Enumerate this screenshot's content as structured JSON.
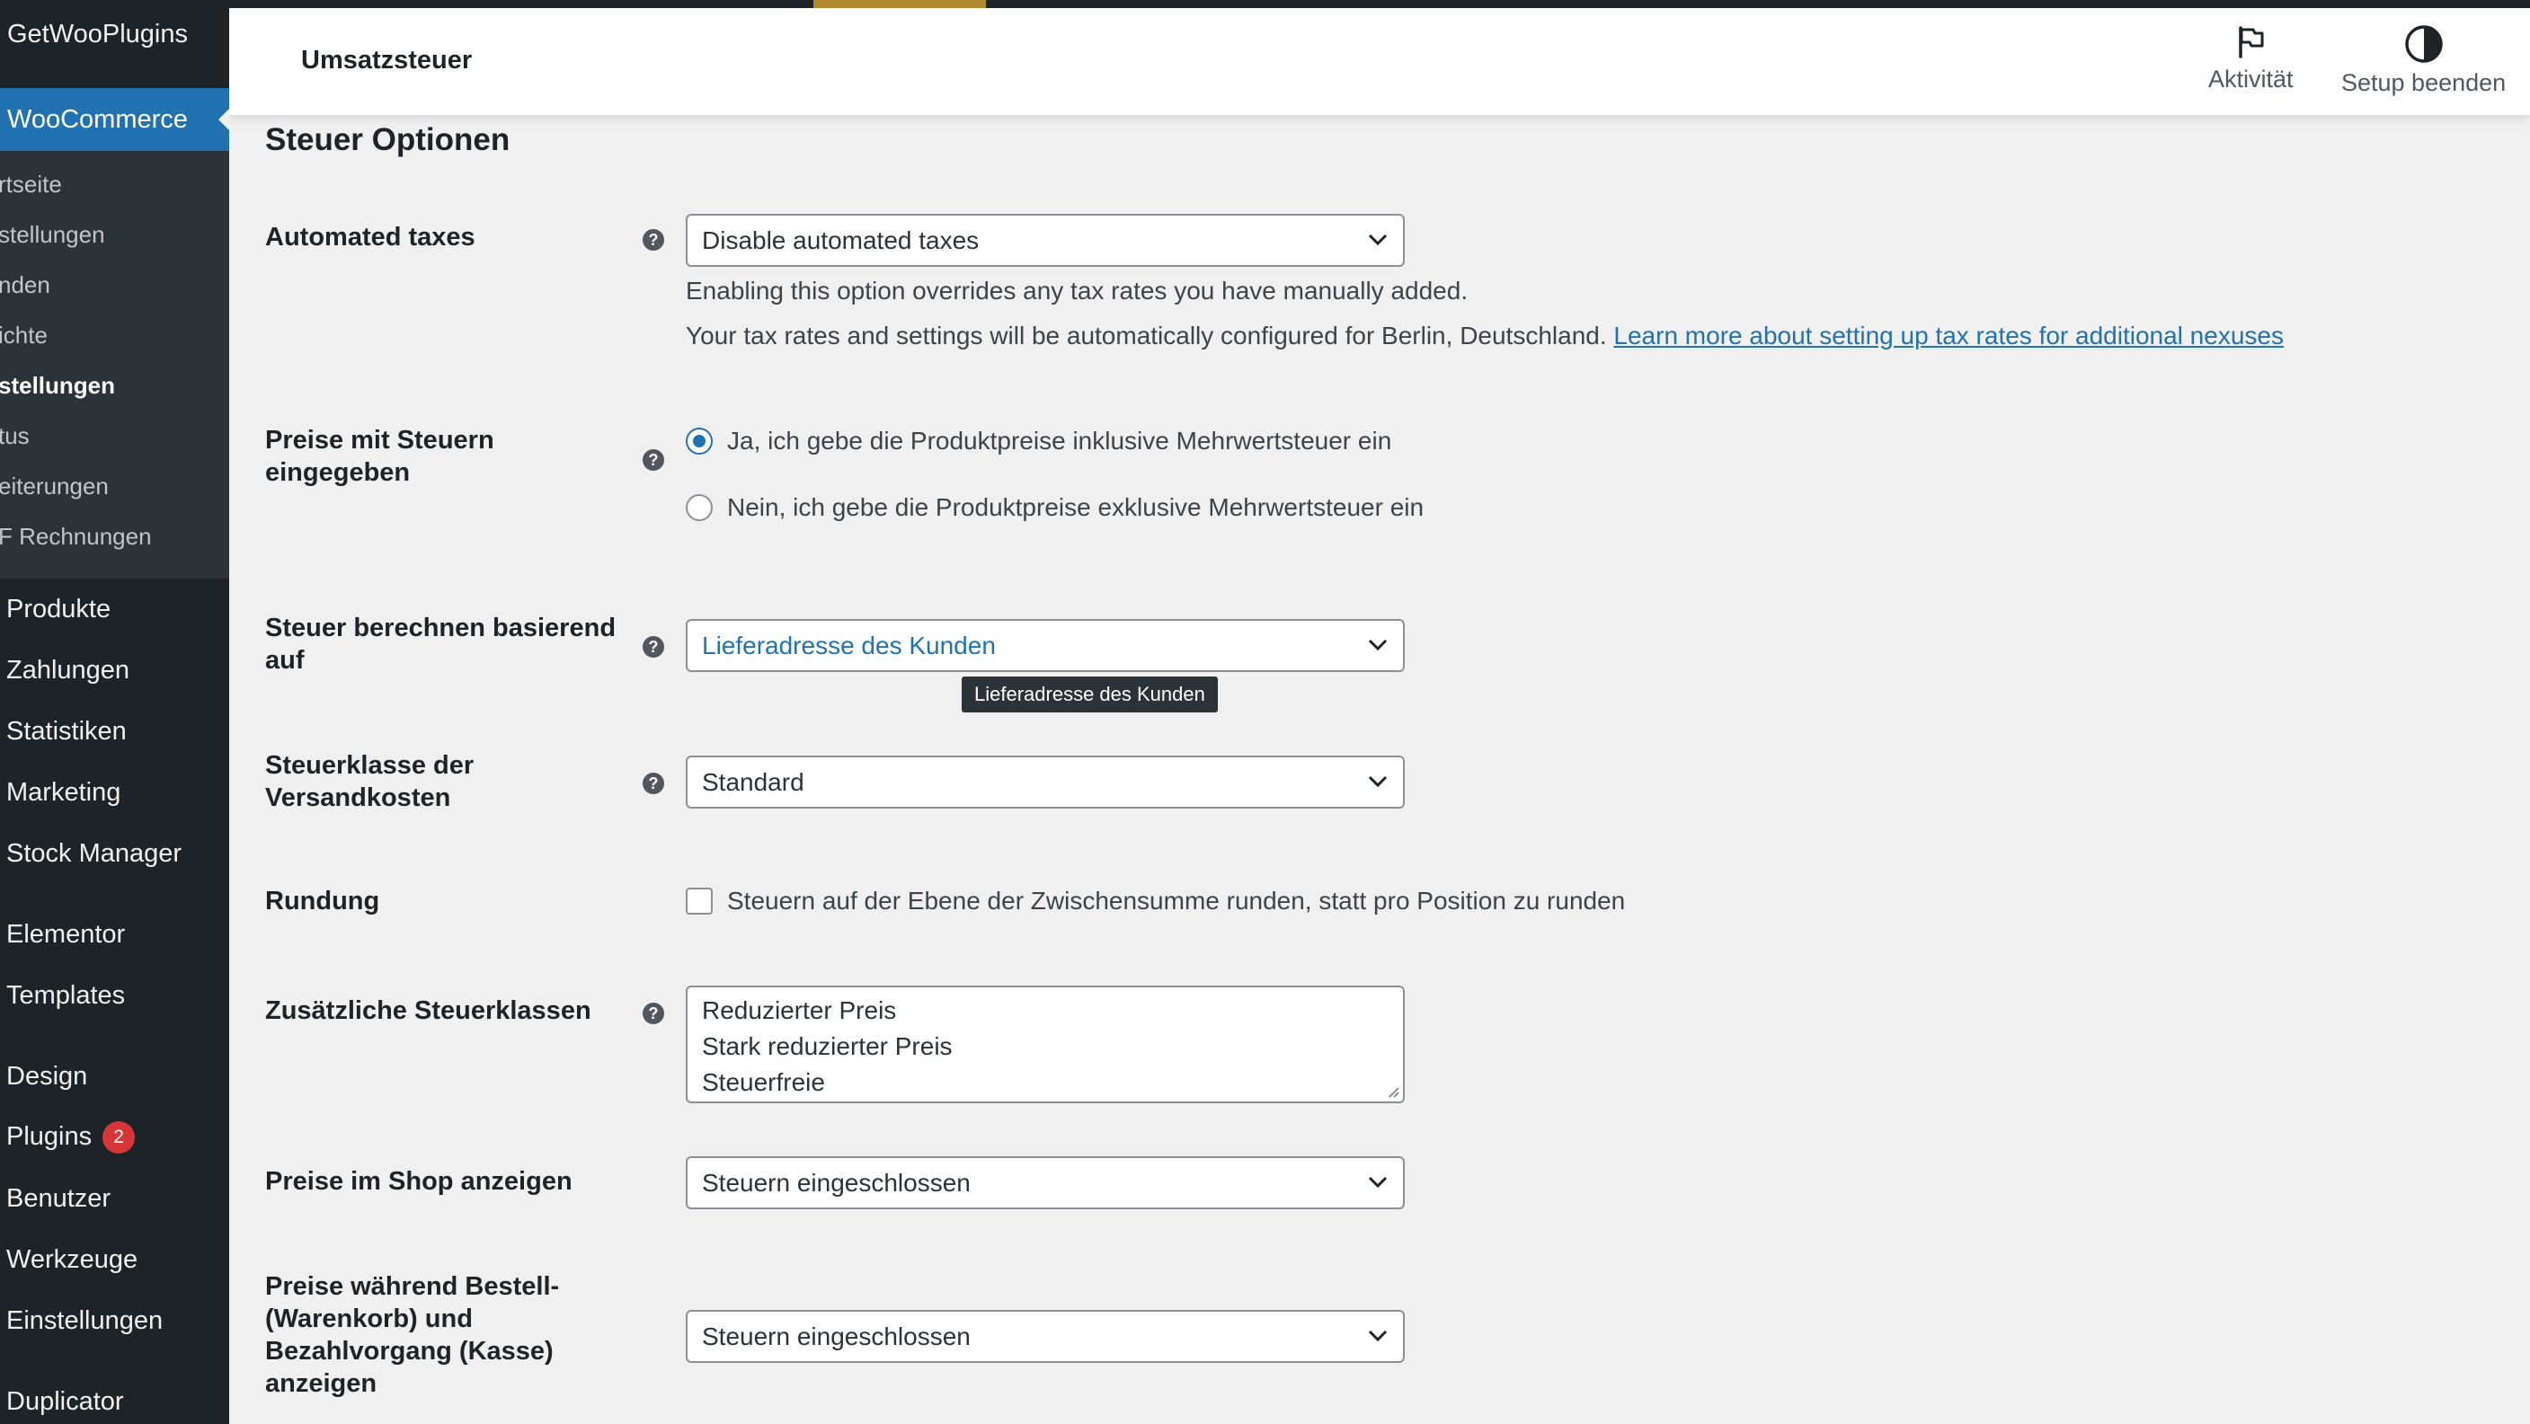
{
  "sidebar": {
    "brand": "GetWooPlugins",
    "woocommerce": "WooCommerce",
    "subitems": [
      "rtseite",
      "stellungen",
      "nden",
      "ichte",
      "stellungen",
      "tus",
      "eiterungen",
      "F Rechnungen"
    ],
    "items": [
      "Produkte",
      "Zahlungen",
      "Statistiken",
      "Marketing",
      "Stock Manager",
      "Elementor",
      "Templates",
      "Design",
      "Plugins",
      "Benutzer",
      "Werkzeuge",
      "Einstellungen",
      "Duplicator"
    ],
    "plugins_badge": "2"
  },
  "header": {
    "title": "Umsatzsteuer",
    "activity_label": "Aktivität",
    "setup_label": "Setup beenden"
  },
  "main": {
    "section_title": "Steuer Optionen",
    "automated_taxes": {
      "label": "Automated taxes",
      "value": "Disable automated taxes",
      "desc1": "Enabling this option overrides any tax rates you have manually added.",
      "desc2": "Your tax rates and settings will be automatically configured for Berlin, Deutschland.",
      "link": "Learn more about setting up tax rates for additional nexuses"
    },
    "prices_entered": {
      "label": "Preise mit Steuern eingegeben",
      "option_yes": "Ja, ich gebe die Produktpreise inklusive Mehrwertsteuer ein",
      "option_no": "Nein, ich gebe die Produktpreise exklusive Mehrwertsteuer ein"
    },
    "calc_based_on": {
      "label": "Steuer berechnen basierend auf",
      "value": "Lieferadresse des Kunden",
      "tooltip": "Lieferadresse des Kunden"
    },
    "shipping_class": {
      "label": "Steuerklasse der Versandkosten",
      "value": "Standard"
    },
    "rounding": {
      "label": "Rundung",
      "checkbox_label": "Steuern auf der Ebene der Zwischensumme runden, statt pro Position zu runden"
    },
    "additional_classes": {
      "label": "Zusätzliche Steuerklassen",
      "lines": [
        "Reduzierter Preis",
        "Stark reduzierter Preis",
        "Steuerfreie"
      ]
    },
    "shop_prices": {
      "label": "Preise im Shop anzeigen",
      "value": "Steuern eingeschlossen"
    },
    "cart_prices": {
      "label": "Preise während Bestell- (Warenkorb) und Bezahlvorgang (Kasse) anzeigen",
      "value": "Steuern eingeschlossen"
    }
  },
  "colors": {
    "sidebar_bg": "#1d2327",
    "accent": "#2271b1",
    "page_bg": "#f0f0f1",
    "badge": "#d63638"
  }
}
